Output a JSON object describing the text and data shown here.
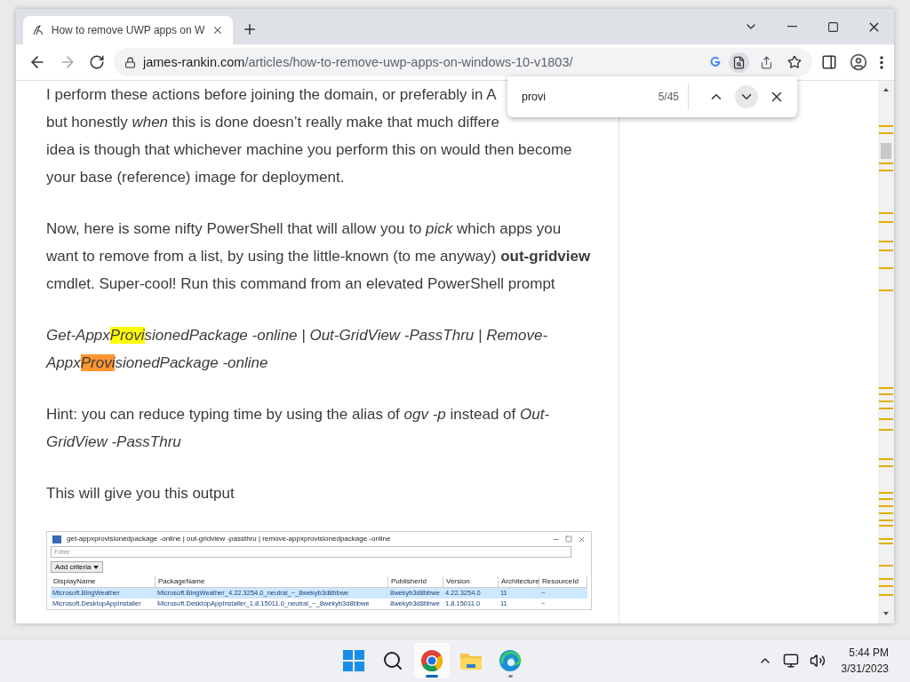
{
  "browser": {
    "tabs": [
      {
        "title": "How to remove UWP apps on W",
        "selected": true
      }
    ],
    "address": {
      "domain": "james-rankin.com",
      "path": "/articles/how-to-remove-uwp-apps-on-windows-10-v1803/"
    }
  },
  "find_bar": {
    "value": "provi",
    "count": "5/45"
  },
  "article": {
    "blocks": [
      {
        "kind": "lines",
        "lines": [
          "I perform these actions before joining the domain, or preferably in A",
          "but honestly *when* this is done doesn’t really make that much differe",
          "idea is though that whichever machine you perform this on would then become",
          "your base (reference) image for deployment."
        ]
      },
      {
        "kind": "text",
        "text": "Now, here is some nifty PowerShell that will allow you to *pick* which apps you want to remove from a list, by using the little-known (to me anyway) **out-gridview** cmdlet. Super-cool! Run this command from an elevated PowerShell prompt"
      },
      {
        "kind": "code",
        "segments": [
          {
            "text": "Get-Appx",
            "highlighted": false,
            "current": false
          },
          {
            "text": "Provi",
            "highlighted": true,
            "current": false
          },
          {
            "text": "sionedPackage -online | Out-GridView -PassThru | Remove-Appx",
            "highlighted": false,
            "current": false
          },
          {
            "text": "Provi",
            "highlighted": true,
            "current": true
          },
          {
            "text": "sionedPackage -online",
            "highlighted": false,
            "current": false
          }
        ]
      },
      {
        "kind": "text",
        "text": "Hint: you can reduce typing time by using the alias of *ogv -p* instead of *Out-GridView -PassThru*"
      },
      {
        "kind": "text",
        "text": "This will give you this output"
      },
      {
        "kind": "screenshot",
        "title": "get-appxprovisionedpackage -online | out-gridview -passthru | remove-appxprovisionedpackage -online",
        "filter_placeholder": "Filter",
        "button": "Add criteria",
        "columns": [
          "DisplayName",
          "PackageName",
          "PublisherId",
          "Version",
          "Architecture",
          "ResourceId"
        ],
        "rows": [
          {
            "selected": true,
            "cells": [
              "Microsoft.BingWeather",
              "Microsoft.BingWeather_4.22.3254.0_neutral_~_8wekyb3d8bbwe",
              "8wekyb3d8bbwe",
              "4.22.3254.0",
              "11",
              "~"
            ]
          },
          {
            "selected": false,
            "cells": [
              "Microsoft.DesktopAppInstaller",
              "Microsoft.DesktopAppInstaller_1.8.15011.0_neutral_~_8wekyb3d8bbwe",
              "8wekyb3d8bbwe",
              "1.8.15011.0",
              "11",
              "~"
            ]
          }
        ]
      }
    ]
  },
  "taskbar": {
    "apps": [
      {
        "kind": "start",
        "active": false,
        "running": false
      },
      {
        "kind": "search",
        "active": false,
        "running": false
      },
      {
        "kind": "chrome",
        "active": true,
        "running": true
      },
      {
        "kind": "files",
        "active": false,
        "running": false
      },
      {
        "kind": "edge",
        "active": false,
        "running": true
      }
    ],
    "clock": {
      "time": "5:44 PM",
      "date": "3/31/2023"
    }
  }
}
